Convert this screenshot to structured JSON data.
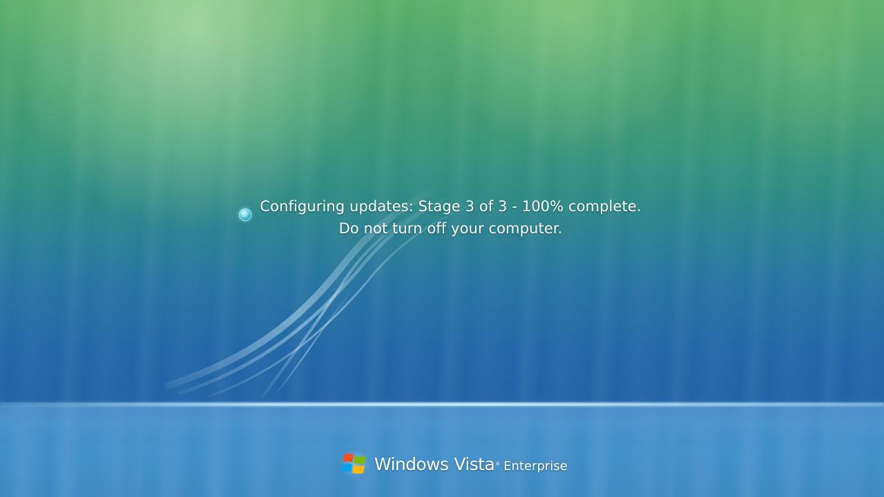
{
  "status": {
    "line1": "Configuring updates: Stage 3 of 3 - 100% complete.",
    "line2": "Do not turn off your computer.",
    "stage_current": 3,
    "stage_total": 3,
    "percent_complete": 100,
    "spinner_icon": "busy-spinner-icon"
  },
  "branding": {
    "windows": "Windows",
    "vista": "Vista",
    "edition": "Enterprise",
    "logo_icon": "windows-flag-icon"
  },
  "colors": {
    "background_top": "#5cae6a",
    "background_mid": "#2877a0",
    "background_bottom": "#3b88c2",
    "text": "#ffffff",
    "flag_red": "#f25022",
    "flag_green": "#7fba00",
    "flag_blue": "#00a4ef",
    "flag_yellow": "#ffb900"
  }
}
